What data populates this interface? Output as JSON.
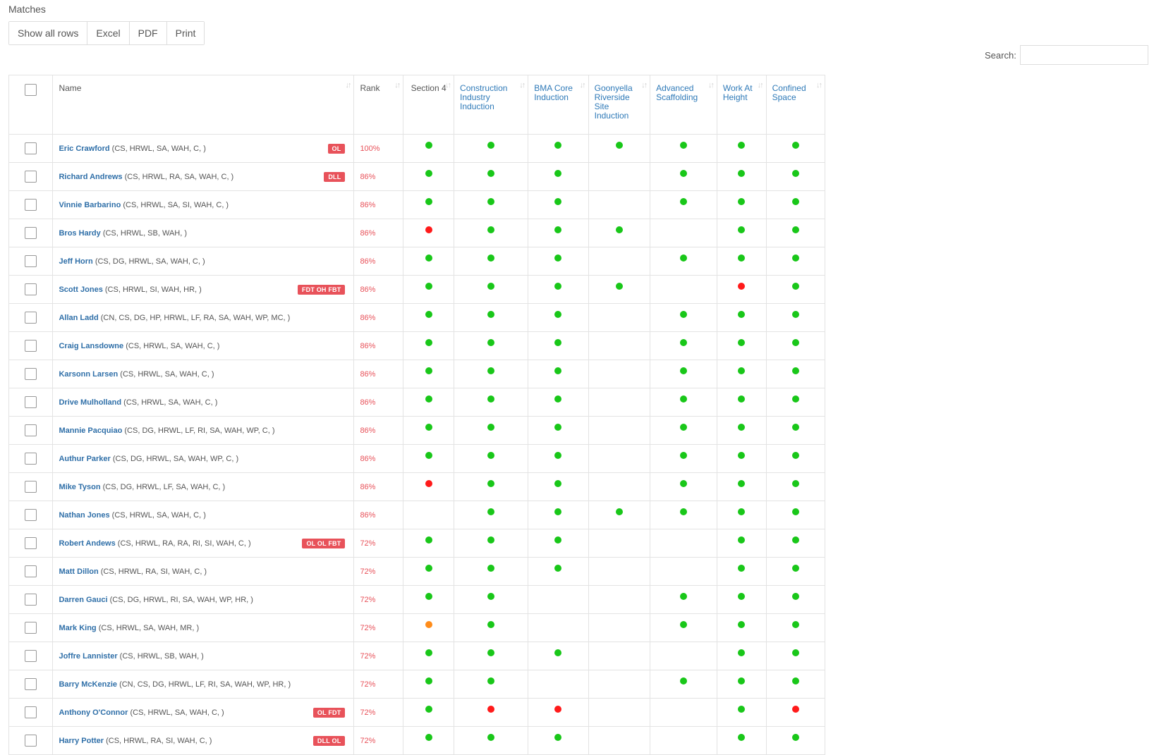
{
  "page": {
    "title": "Matches"
  },
  "toolbar": {
    "buttons": [
      "Show all rows",
      "Excel",
      "PDF",
      "Print"
    ]
  },
  "search": {
    "label": "Search:",
    "value": ""
  },
  "table": {
    "columns": [
      {
        "label": "Name",
        "style": "plain"
      },
      {
        "label": "Rank",
        "style": "plain"
      },
      {
        "label": "Section 4",
        "style": "plain"
      },
      {
        "label": "Construction Industry Induction",
        "style": "link"
      },
      {
        "label": "BMA Core Induction",
        "style": "link"
      },
      {
        "label": "Goonyella Riverside Site Induction",
        "style": "link"
      },
      {
        "label": "Advanced Scaffolding",
        "style": "link"
      },
      {
        "label": "Work At Height",
        "style": "link"
      },
      {
        "label": "Confined Space",
        "style": "link"
      }
    ],
    "status_colors": {
      "g": "#19c719",
      "r": "#ff1a1a",
      "o": "#ff8c1a"
    },
    "rows": [
      {
        "name": "Eric Crawford",
        "quals": "(CS, HRWL, SA, WAH, C, )",
        "badge": "OL",
        "rank": "100%",
        "status": [
          "g",
          "g",
          "g",
          "g",
          "g",
          "g",
          "g"
        ]
      },
      {
        "name": "Richard Andrews",
        "quals": "(CS, HRWL, RA, SA, WAH, C, )",
        "badge": "DLL",
        "rank": "86%",
        "status": [
          "g",
          "g",
          "g",
          "",
          "g",
          "g",
          "g"
        ]
      },
      {
        "name": "Vinnie Barbarino",
        "quals": "(CS, HRWL, SA, SI, WAH, C, )",
        "badge": "",
        "rank": "86%",
        "status": [
          "g",
          "g",
          "g",
          "",
          "g",
          "g",
          "g"
        ]
      },
      {
        "name": "Bros Hardy",
        "quals": "(CS, HRWL, SB, WAH, )",
        "badge": "",
        "rank": "86%",
        "status": [
          "r",
          "g",
          "g",
          "g",
          "",
          "g",
          "g"
        ]
      },
      {
        "name": "Jeff Horn",
        "quals": "(CS, DG, HRWL, SA, WAH, C, )",
        "badge": "",
        "rank": "86%",
        "status": [
          "g",
          "g",
          "g",
          "",
          "g",
          "g",
          "g"
        ]
      },
      {
        "name": "Scott Jones",
        "quals": "(CS, HRWL, SI, WAH, HR, )",
        "badge": "FDT OH FBT",
        "rank": "86%",
        "status": [
          "g",
          "g",
          "g",
          "g",
          "",
          "r",
          "g"
        ]
      },
      {
        "name": "Allan Ladd",
        "quals": "(CN, CS, DG, HP, HRWL, LF, RA, SA, WAH, WP, MC, )",
        "badge": "",
        "rank": "86%",
        "status": [
          "g",
          "g",
          "g",
          "",
          "g",
          "g",
          "g"
        ]
      },
      {
        "name": "Craig Lansdowne",
        "quals": "(CS, HRWL, SA, WAH, C, )",
        "badge": "",
        "rank": "86%",
        "status": [
          "g",
          "g",
          "g",
          "",
          "g",
          "g",
          "g"
        ]
      },
      {
        "name": "Karsonn Larsen",
        "quals": "(CS, HRWL, SA, WAH, C, )",
        "badge": "",
        "rank": "86%",
        "status": [
          "g",
          "g",
          "g",
          "",
          "g",
          "g",
          "g"
        ]
      },
      {
        "name": "Drive Mulholland",
        "quals": "(CS, HRWL, SA, WAH, C, )",
        "badge": "",
        "rank": "86%",
        "status": [
          "g",
          "g",
          "g",
          "",
          "g",
          "g",
          "g"
        ]
      },
      {
        "name": "Mannie Pacquiao",
        "quals": "(CS, DG, HRWL, LF, RI, SA, WAH, WP, C, )",
        "badge": "",
        "rank": "86%",
        "status": [
          "g",
          "g",
          "g",
          "",
          "g",
          "g",
          "g"
        ]
      },
      {
        "name": "Authur Parker",
        "quals": "(CS, DG, HRWL, SA, WAH, WP, C, )",
        "badge": "",
        "rank": "86%",
        "status": [
          "g",
          "g",
          "g",
          "",
          "g",
          "g",
          "g"
        ]
      },
      {
        "name": "Mike Tyson",
        "quals": "(CS, DG, HRWL, LF, SA, WAH, C, )",
        "badge": "",
        "rank": "86%",
        "status": [
          "r",
          "g",
          "g",
          "",
          "g",
          "g",
          "g"
        ]
      },
      {
        "name": "Nathan Jones",
        "quals": "(CS, HRWL, SA, WAH, C, )",
        "badge": "",
        "rank": "86%",
        "status": [
          "",
          "g",
          "g",
          "g",
          "g",
          "g",
          "g"
        ]
      },
      {
        "name": "Robert Andews",
        "quals": "(CS, HRWL, RA, RA, RI, SI, WAH, C, )",
        "badge": "OL OL FBT",
        "rank": "72%",
        "status": [
          "g",
          "g",
          "g",
          "",
          "",
          "g",
          "g"
        ]
      },
      {
        "name": "Matt Dillon",
        "quals": "(CS, HRWL, RA, SI, WAH, C, )",
        "badge": "",
        "rank": "72%",
        "status": [
          "g",
          "g",
          "g",
          "",
          "",
          "g",
          "g"
        ]
      },
      {
        "name": "Darren Gauci",
        "quals": "(CS, DG, HRWL, RI, SA, WAH, WP, HR, )",
        "badge": "",
        "rank": "72%",
        "status": [
          "g",
          "g",
          "",
          "",
          "g",
          "g",
          "g"
        ]
      },
      {
        "name": "Mark King",
        "quals": "(CS, HRWL, SA, WAH, MR, )",
        "badge": "",
        "rank": "72%",
        "status": [
          "o",
          "g",
          "",
          "",
          "g",
          "g",
          "g"
        ]
      },
      {
        "name": "Joffre Lannister",
        "quals": "(CS, HRWL, SB, WAH, )",
        "badge": "",
        "rank": "72%",
        "status": [
          "g",
          "g",
          "g",
          "",
          "",
          "g",
          "g"
        ]
      },
      {
        "name": "Barry McKenzie",
        "quals": "(CN, CS, DG, HRWL, LF, RI, SA, WAH, WP, HR, )",
        "badge": "",
        "rank": "72%",
        "status": [
          "g",
          "g",
          "",
          "",
          "g",
          "g",
          "g"
        ]
      },
      {
        "name": "Anthony O'Connor",
        "quals": "(CS, HRWL, SA, WAH, C, )",
        "badge": "OL FDT",
        "rank": "72%",
        "status": [
          "g",
          "r",
          "r",
          "",
          "",
          "g",
          "r"
        ]
      },
      {
        "name": "Harry Potter",
        "quals": "(CS, HRWL, RA, SI, WAH, C, )",
        "badge": "DLL OL",
        "rank": "72%",
        "status": [
          "g",
          "g",
          "g",
          "",
          "",
          "g",
          "g"
        ]
      }
    ]
  }
}
